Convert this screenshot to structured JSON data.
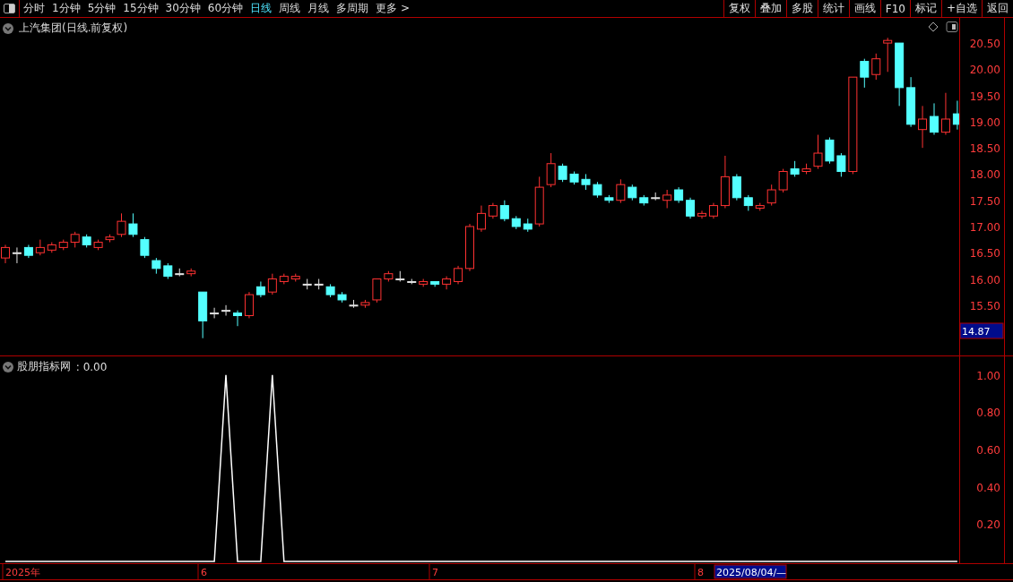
{
  "toolbar": {
    "periods": [
      {
        "label": "分时",
        "selected": false
      },
      {
        "label": "1分钟",
        "selected": false
      },
      {
        "label": "5分钟",
        "selected": false
      },
      {
        "label": "15分钟",
        "selected": false
      },
      {
        "label": "30分钟",
        "selected": false
      },
      {
        "label": "60分钟",
        "selected": false
      },
      {
        "label": "日线",
        "selected": true
      },
      {
        "label": "周线",
        "selected": false
      },
      {
        "label": "月线",
        "selected": false
      },
      {
        "label": "多周期",
        "selected": false
      }
    ],
    "more": "更多 >",
    "buttons": [
      "复权",
      "叠加",
      "多股",
      "统计",
      "画线",
      "F10",
      "标记",
      "+自选",
      "返回"
    ]
  },
  "main_chart": {
    "title": "上汽集团(日线.前复权)",
    "low_price_tag": "14.87",
    "chart_data": {
      "type": "candlestick",
      "ylim": [
        14.54,
        20.98
      ],
      "yticks": [
        {
          "value": 20.5,
          "label": "20.50"
        },
        {
          "value": 20,
          "label": "20.00"
        },
        {
          "value": 19.5,
          "label": "19.50"
        },
        {
          "value": 19,
          "label": "19.00"
        },
        {
          "value": 18.5,
          "label": "18.50"
        },
        {
          "value": 18,
          "label": "18.00"
        },
        {
          "value": 17.5,
          "label": "17.50"
        },
        {
          "value": 17,
          "label": "17.00"
        },
        {
          "value": 16.5,
          "label": "16.50"
        },
        {
          "value": 16,
          "label": "16.00"
        },
        {
          "value": 15.5,
          "label": "15.50"
        }
      ],
      "ohlc": [
        [
          16.4,
          16.65,
          16.3,
          16.6
        ],
        [
          16.5,
          16.6,
          16.3,
          16.5
        ],
        [
          16.6,
          16.65,
          16.4,
          16.45
        ],
        [
          16.5,
          16.75,
          16.45,
          16.6
        ],
        [
          16.55,
          16.7,
          16.5,
          16.65
        ],
        [
          16.6,
          16.75,
          16.55,
          16.7
        ],
        [
          16.7,
          16.9,
          16.6,
          16.85
        ],
        [
          16.8,
          16.85,
          16.6,
          16.65
        ],
        [
          16.6,
          16.75,
          16.55,
          16.7
        ],
        [
          16.75,
          16.85,
          16.7,
          16.8
        ],
        [
          16.85,
          17.25,
          16.8,
          17.1
        ],
        [
          17.05,
          17.25,
          16.8,
          16.85
        ],
        [
          16.75,
          16.8,
          16.4,
          16.45
        ],
        [
          16.35,
          16.4,
          16.1,
          16.2
        ],
        [
          16.25,
          16.3,
          16.0,
          16.05
        ],
        [
          16.1,
          16.2,
          16.05,
          16.1
        ],
        [
          16.1,
          16.2,
          16.05,
          16.15
        ],
        [
          15.75,
          15.75,
          14.87,
          15.2
        ],
        [
          15.35,
          15.45,
          15.25,
          15.35
        ],
        [
          15.4,
          15.5,
          15.3,
          15.4
        ],
        [
          15.35,
          15.4,
          15.1,
          15.3
        ],
        [
          15.3,
          15.75,
          15.25,
          15.7
        ],
        [
          15.85,
          15.95,
          15.65,
          15.7
        ],
        [
          15.75,
          16.1,
          15.7,
          16.0
        ],
        [
          15.95,
          16.1,
          15.9,
          16.05
        ],
        [
          16.0,
          16.1,
          15.95,
          16.05
        ],
        [
          15.9,
          16.0,
          15.8,
          15.9
        ],
        [
          15.9,
          16.0,
          15.8,
          15.9
        ],
        [
          15.85,
          15.9,
          15.65,
          15.7
        ],
        [
          15.7,
          15.75,
          15.55,
          15.6
        ],
        [
          15.5,
          15.6,
          15.45,
          15.5
        ],
        [
          15.5,
          15.6,
          15.45,
          15.55
        ],
        [
          15.6,
          16.0,
          15.55,
          16.0
        ],
        [
          16.0,
          16.15,
          15.95,
          16.1
        ],
        [
          16.0,
          16.15,
          15.95,
          16.0
        ],
        [
          15.95,
          16.0,
          15.9,
          15.95
        ],
        [
          15.9,
          16.0,
          15.85,
          15.95
        ],
        [
          15.95,
          15.95,
          15.85,
          15.9
        ],
        [
          15.9,
          16.05,
          15.8,
          16.0
        ],
        [
          15.95,
          16.25,
          15.9,
          16.2
        ],
        [
          16.2,
          17.05,
          16.15,
          17.0
        ],
        [
          16.95,
          17.4,
          16.9,
          17.25
        ],
        [
          17.2,
          17.45,
          17.15,
          17.4
        ],
        [
          17.4,
          17.5,
          17.1,
          17.15
        ],
        [
          17.15,
          17.2,
          16.95,
          17.0
        ],
        [
          17.05,
          17.15,
          16.9,
          16.95
        ],
        [
          17.05,
          17.95,
          17.0,
          17.75
        ],
        [
          17.8,
          18.4,
          17.75,
          18.2
        ],
        [
          18.15,
          18.2,
          17.85,
          17.9
        ],
        [
          18.0,
          18.05,
          17.8,
          17.85
        ],
        [
          17.9,
          18.0,
          17.7,
          17.8
        ],
        [
          17.8,
          17.85,
          17.55,
          17.6
        ],
        [
          17.55,
          17.6,
          17.45,
          17.5
        ],
        [
          17.5,
          17.9,
          17.45,
          17.8
        ],
        [
          17.75,
          17.8,
          17.5,
          17.55
        ],
        [
          17.55,
          17.6,
          17.4,
          17.45
        ],
        [
          17.55,
          17.65,
          17.5,
          17.55
        ],
        [
          17.5,
          17.7,
          17.35,
          17.6
        ],
        [
          17.7,
          17.75,
          17.45,
          17.5
        ],
        [
          17.5,
          17.55,
          17.15,
          17.2
        ],
        [
          17.2,
          17.3,
          17.15,
          17.25
        ],
        [
          17.2,
          17.45,
          17.15,
          17.4
        ],
        [
          17.4,
          18.35,
          17.35,
          17.95
        ],
        [
          17.95,
          18.0,
          17.5,
          17.55
        ],
        [
          17.55,
          17.6,
          17.3,
          17.4
        ],
        [
          17.35,
          17.45,
          17.3,
          17.4
        ],
        [
          17.45,
          17.8,
          17.4,
          17.7
        ],
        [
          17.7,
          18.1,
          17.65,
          18.05
        ],
        [
          18.1,
          18.25,
          17.95,
          18.0
        ],
        [
          18.05,
          18.2,
          18.0,
          18.1
        ],
        [
          18.15,
          18.75,
          18.1,
          18.4
        ],
        [
          18.65,
          18.7,
          18.2,
          18.25
        ],
        [
          18.35,
          18.4,
          17.95,
          18.05
        ],
        [
          18.05,
          19.85,
          18.0,
          19.85
        ],
        [
          20.15,
          20.2,
          19.65,
          19.85
        ],
        [
          19.9,
          20.3,
          19.8,
          20.2
        ],
        [
          20.5,
          20.6,
          19.95,
          20.55
        ],
        [
          20.5,
          20.5,
          19.3,
          19.65
        ],
        [
          19.65,
          19.85,
          18.9,
          18.95
        ],
        [
          18.85,
          19.3,
          18.5,
          19.05
        ],
        [
          19.1,
          19.35,
          18.75,
          18.8
        ],
        [
          18.8,
          19.55,
          18.75,
          19.05
        ],
        [
          19.15,
          19.4,
          18.85,
          18.95
        ]
      ]
    }
  },
  "indicator": {
    "reading": " : 0.00",
    "chart_data": {
      "type": "line",
      "ylim": [
        0,
        1.1
      ],
      "yticks": [
        {
          "value": 0.2,
          "label": "0.20"
        },
        {
          "value": 0.4,
          "label": "0.40"
        },
        {
          "value": 0.6,
          "label": "0.60"
        },
        {
          "value": 0.8,
          "label": "0.80"
        },
        {
          "value": 1,
          "label": "1.00"
        }
      ],
      "series": [
        {
          "name": "股朋指标网",
          "color": "#ffffff",
          "values": [
            0,
            0,
            0,
            0,
            0,
            0,
            0,
            0,
            0,
            0,
            0,
            0,
            0,
            0,
            0,
            0,
            0,
            0,
            0,
            1,
            0,
            0,
            0,
            1,
            0,
            0,
            0,
            0,
            0,
            0,
            0,
            0,
            0,
            0,
            0,
            0,
            0,
            0,
            0,
            0,
            0,
            0,
            0,
            0,
            0,
            0,
            0,
            0,
            0,
            0,
            0,
            0,
            0,
            0,
            0,
            0,
            0,
            0,
            0,
            0,
            0,
            0,
            0,
            0,
            0,
            0,
            0,
            0,
            0,
            0,
            0,
            0,
            0,
            0,
            0,
            0,
            0,
            0,
            0,
            0,
            0,
            0,
            0
          ]
        }
      ]
    }
  },
  "date_axis": {
    "labels": [
      "2025年",
      "6",
      "7",
      "8"
    ],
    "cursor_label": "2025/08/04/—"
  }
}
